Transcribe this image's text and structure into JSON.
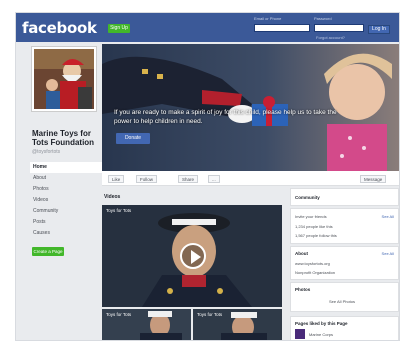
{
  "topbar": {
    "logo": "facebook",
    "signup_label": "Sign Up",
    "email_label": "Email or Phone",
    "password_label": "Password",
    "email_placeholder": "",
    "password_placeholder": "",
    "login_label": "Log In",
    "forgot_label": "Forgot account?"
  },
  "page": {
    "name": "Marine Toys for Tots Foundation",
    "handle": "@toysfortots"
  },
  "leftnav": {
    "items": [
      {
        "label": "Home"
      },
      {
        "label": "About"
      },
      {
        "label": "Photos"
      },
      {
        "label": "Videos"
      },
      {
        "label": "Community"
      },
      {
        "label": "Posts"
      },
      {
        "label": "Causes"
      }
    ],
    "create_page_label": "Create a Page"
  },
  "cover": {
    "caption": "If you are ready to make a spirit of joy for this child, please help us to take the power to help children in need.",
    "button_label": "Donate"
  },
  "actions": {
    "like": "Like",
    "follow": "Follow",
    "share": "Share",
    "more": "...",
    "message": "Message"
  },
  "videos": {
    "label": "Videos",
    "main_title": "Toys for Tots",
    "thumb1_title": "Toys for Tots",
    "thumb2_title": "Toys for Tots"
  },
  "sidebar": {
    "card1_title": "Community",
    "card1_link": "See All",
    "card1_line1": "Invite your friends",
    "card1_line2": "1,234 people like this",
    "card1_line3": "1,567 people follow this",
    "card2_title": "About",
    "card2_link": "See All",
    "card2_line1": "www.toysfortots.org",
    "card2_line2": "Nonprofit Organization",
    "card3_title": "Photos",
    "card3_value": "See All Photos",
    "card4_title": "Pages liked by this Page",
    "card4_line1": "Marine Corps"
  },
  "colors": {
    "brand": "#3b5998",
    "green": "#42b72a",
    "link": "#4267b2"
  }
}
